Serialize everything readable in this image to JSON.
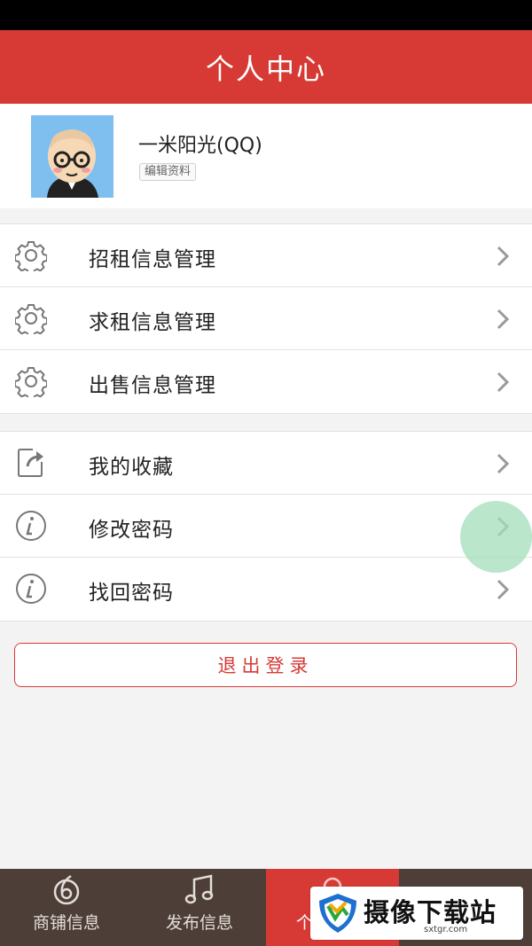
{
  "header": {
    "title": "个人中心"
  },
  "profile": {
    "username": "一米阳光(QQ)",
    "edit_label": "编辑资料"
  },
  "menu_groups": [
    {
      "items": [
        {
          "label": "招租信息管理",
          "icon": "gear-icon"
        },
        {
          "label": "求租信息管理",
          "icon": "gear-icon"
        },
        {
          "label": "出售信息管理",
          "icon": "gear-icon"
        }
      ]
    },
    {
      "items": [
        {
          "label": "我的收藏",
          "icon": "share-icon"
        },
        {
          "label": "修改密码",
          "icon": "info-icon"
        },
        {
          "label": "找回密码",
          "icon": "info-icon"
        }
      ]
    }
  ],
  "logout_label": "退出登录",
  "tabs": [
    {
      "label": "商铺信息",
      "icon": "swirl-icon"
    },
    {
      "label": "发布信息",
      "icon": "music-note-icon"
    },
    {
      "label": "个",
      "icon": "person-icon"
    },
    {
      "label": "",
      "icon": "search-icon"
    }
  ],
  "watermark": {
    "name": "摄像下载站",
    "url": "sxtgr.com"
  },
  "colors": {
    "brand_red": "#d73a35",
    "tabbar": "#4d3f38",
    "fab": "#a3deba"
  }
}
